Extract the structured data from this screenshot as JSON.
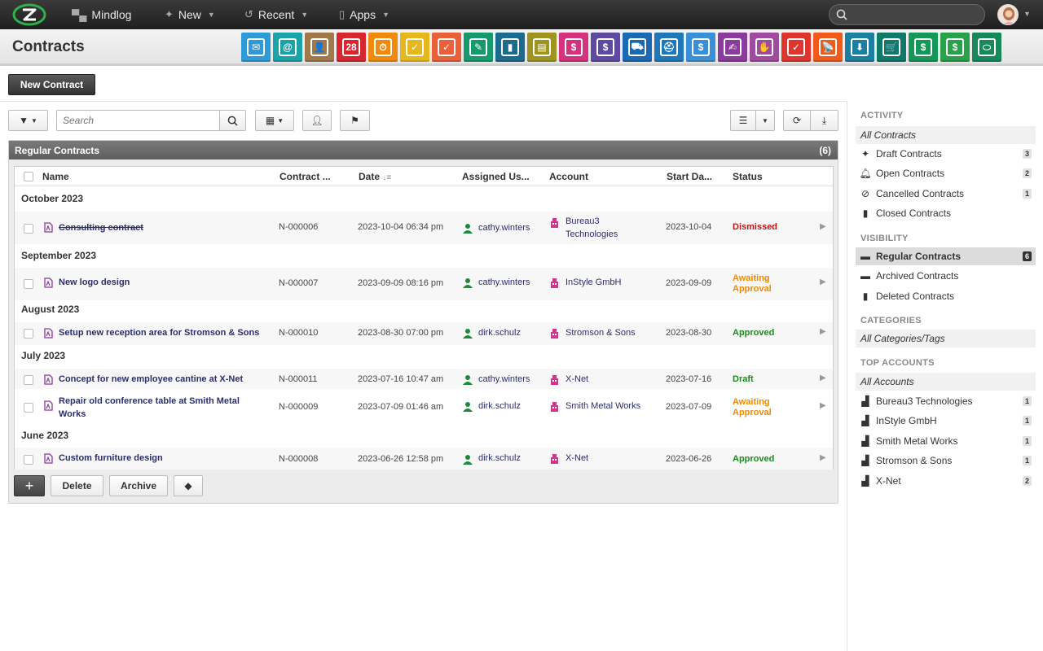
{
  "topbar": {
    "items": [
      {
        "label": "Mindlog",
        "icon": "mindlog-icon"
      },
      {
        "label": "New",
        "icon": "sparkle-icon"
      },
      {
        "label": "Recent",
        "icon": "history-icon"
      },
      {
        "label": "Apps",
        "icon": "tablet-icon"
      }
    ]
  },
  "header": {
    "title": "Contracts",
    "apps": [
      {
        "name": "email",
        "color": "#2e9bd6",
        "glyph": "✉"
      },
      {
        "name": "contacts-at",
        "color": "#1aa3a8",
        "glyph": "@"
      },
      {
        "name": "address-book",
        "color": "#a0784a",
        "glyph": "👤"
      },
      {
        "name": "calendar",
        "color": "#d8262f",
        "glyph": "28"
      },
      {
        "name": "timer",
        "color": "#f08a0c",
        "glyph": "⏱"
      },
      {
        "name": "tasks",
        "color": "#e6b81e",
        "glyph": "✓"
      },
      {
        "name": "projects",
        "color": "#e9603a",
        "glyph": "✓"
      },
      {
        "name": "notes",
        "color": "#15996d",
        "glyph": "✎"
      },
      {
        "name": "bookmarks",
        "color": "#1d6a8f",
        "glyph": "▮"
      },
      {
        "name": "documents",
        "color": "#9d9520",
        "glyph": "▤"
      },
      {
        "name": "reception",
        "color": "#d4327e",
        "glyph": "$"
      },
      {
        "name": "finance",
        "color": "#5e4aa0",
        "glyph": "$"
      },
      {
        "name": "delivery",
        "color": "#1c69b3",
        "glyph": "⛟"
      },
      {
        "name": "support",
        "color": "#2078b8",
        "glyph": "⛑"
      },
      {
        "name": "money-bag",
        "color": "#3a8fd6",
        "glyph": "$"
      },
      {
        "name": "contracts",
        "color": "#8a3b9c",
        "glyph": "✍"
      },
      {
        "name": "deals",
        "color": "#a04aa0",
        "glyph": "✋"
      },
      {
        "name": "invoices",
        "color": "#e0352f",
        "glyph": "✓"
      },
      {
        "name": "broadcast",
        "color": "#f05a1a",
        "glyph": "📡"
      },
      {
        "name": "downloads",
        "color": "#1a7fa0",
        "glyph": "⬇"
      },
      {
        "name": "shop",
        "color": "#0f7a6a",
        "glyph": "🛒"
      },
      {
        "name": "cash",
        "color": "#16975a",
        "glyph": "$"
      },
      {
        "name": "pricing",
        "color": "#2aa04a",
        "glyph": "$"
      },
      {
        "name": "database",
        "color": "#16885a",
        "glyph": "⬭"
      }
    ]
  },
  "new_button": "New Contract",
  "search": {
    "placeholder": "Search"
  },
  "panel": {
    "title": "Regular Contracts",
    "count": "(6)"
  },
  "columns": {
    "name": "Name",
    "contract": "Contract ...",
    "date": "Date",
    "user": "Assigned Us...",
    "account": "Account",
    "start": "Start Da...",
    "status": "Status"
  },
  "groups": [
    "October 2023",
    "September 2023",
    "August 2023",
    "July 2023",
    "June 2023"
  ],
  "rows": [
    {
      "name": "Consulting contract",
      "number": "N-000006",
      "date": "2023-10-04 06:34 pm",
      "user": "cathy.winters",
      "account_line1": "Bureau3",
      "account_line2": "Technologies",
      "start": "2023-10-04",
      "status_line1": "Dismissed",
      "status_line2": ""
    },
    {
      "name": "New logo design",
      "number": "N-000007",
      "date": "2023-09-09 08:16 pm",
      "user": "cathy.winters",
      "account_line1": "InStyle GmbH",
      "account_line2": "",
      "start": "2023-09-09",
      "status_line1": "Awaiting",
      "status_line2": "Approval"
    },
    {
      "name": "Setup new reception area for Stromson & Sons",
      "number": "N-000010",
      "date": "2023-08-30 07:00 pm",
      "user": "dirk.schulz",
      "account_line1": "Stromson & Sons",
      "account_line2": "",
      "start": "2023-08-30",
      "status_line1": "Approved",
      "status_line2": ""
    },
    {
      "name": "Concept for new employee cantine at X-Net",
      "number": "N-000011",
      "date": "2023-07-16 10:47 am",
      "user": "cathy.winters",
      "account_line1": "X-Net",
      "account_line2": "",
      "start": "2023-07-16",
      "status_line1": "Draft",
      "status_line2": ""
    },
    {
      "name_line1": "Repair old conference table at Smith Metal",
      "name_line2": "Works",
      "number": "N-000009",
      "date": "2023-07-09 01:46 am",
      "user": "dirk.schulz",
      "account_line1": "Smith Metal Works",
      "account_line2": "",
      "start": "2023-07-09",
      "status_line1": "Awaiting",
      "status_line2": "Approval"
    },
    {
      "name": "Custom furniture design",
      "number": "N-000008",
      "date": "2023-06-26 12:58 pm",
      "user": "dirk.schulz",
      "account_line1": "X-Net",
      "account_line2": "",
      "start": "2023-06-26",
      "status_line1": "Approved",
      "status_line2": ""
    }
  ],
  "bottom": {
    "add": "+",
    "delete": "Delete",
    "archive": "Archive"
  },
  "sidebar": {
    "activity_header": "ACTIVITY",
    "activity_all": "All Contracts",
    "activity": [
      {
        "label": "Draft Contracts",
        "count": "3",
        "icon": "sparkle-icon"
      },
      {
        "label": "Open Contracts",
        "count": "2",
        "icon": "bell-icon"
      },
      {
        "label": "Cancelled Contracts",
        "count": "1",
        "icon": "ban-icon"
      },
      {
        "label": "Closed Contracts",
        "count": "",
        "icon": "book-icon"
      }
    ],
    "visibility_header": "VISIBILITY",
    "visibility": [
      {
        "label": "Regular Contracts",
        "count": "6",
        "icon": "inbox-icon"
      },
      {
        "label": "Archived Contracts",
        "count": "",
        "icon": "archive-icon"
      },
      {
        "label": "Deleted Contracts",
        "count": "",
        "icon": "trash-icon"
      }
    ],
    "categories_header": "CATEGORIES",
    "categories_all": "All Categories/Tags",
    "accounts_header": "TOP ACCOUNTS",
    "accounts_all": "All Accounts",
    "accounts": [
      {
        "label": "Bureau3 Technologies",
        "count": "1"
      },
      {
        "label": "InStyle GmbH",
        "count": "1"
      },
      {
        "label": "Smith Metal Works",
        "count": "1"
      },
      {
        "label": "Stromson & Sons",
        "count": "1"
      },
      {
        "label": "X-Net",
        "count": "2"
      }
    ]
  }
}
